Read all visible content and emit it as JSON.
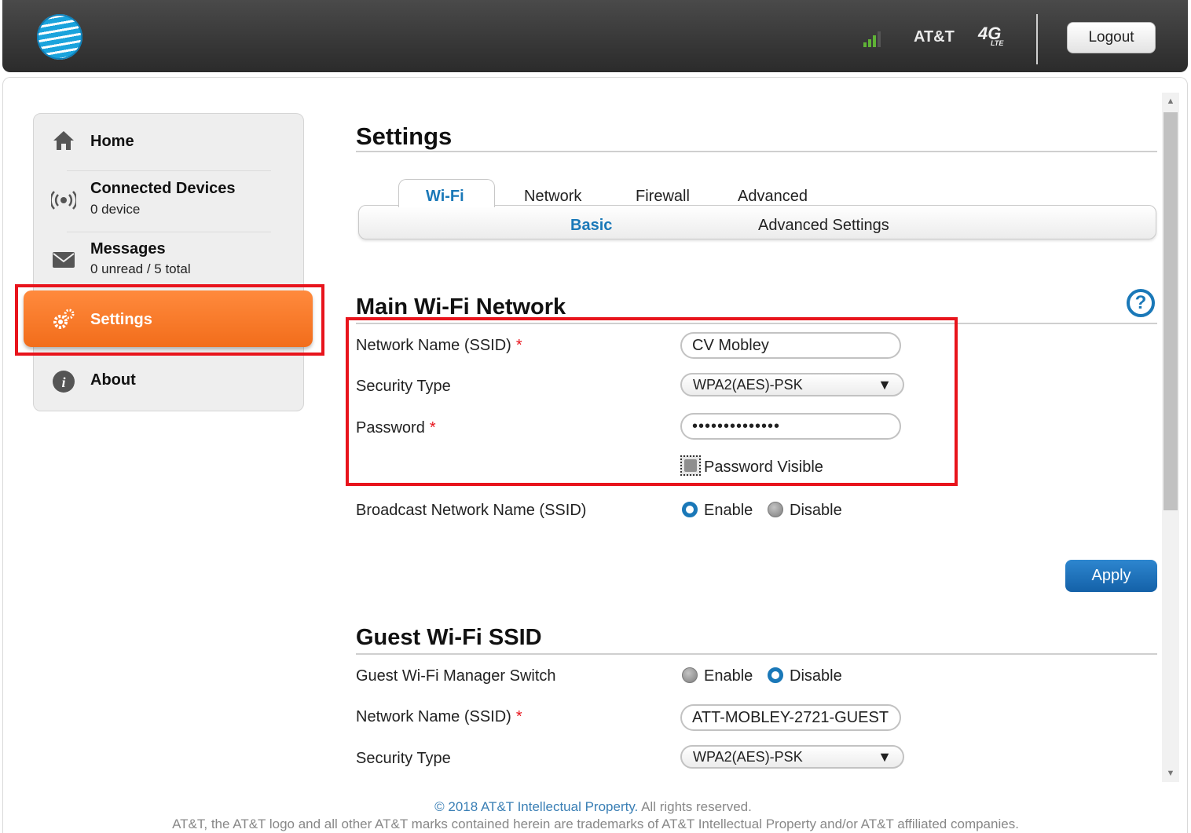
{
  "header": {
    "carrier": "AT&T",
    "network_badge": "4G",
    "network_badge_sub": "LTE",
    "logout_label": "Logout",
    "signal_bars": 3
  },
  "sidebar": {
    "home": {
      "label": "Home"
    },
    "connected_devices": {
      "label": "Connected Devices",
      "sub": "0 device"
    },
    "messages": {
      "label": "Messages",
      "sub": "0 unread / 5 total"
    },
    "settings": {
      "label": "Settings"
    },
    "about": {
      "label": "About"
    }
  },
  "page_title": "Settings",
  "tabs": [
    {
      "label": "Wi-Fi",
      "active": true
    },
    {
      "label": "Network",
      "active": false
    },
    {
      "label": "Firewall",
      "active": false
    },
    {
      "label": "Advanced",
      "active": false
    }
  ],
  "subtabs": [
    {
      "label": "Basic",
      "active": true
    },
    {
      "label": "Advanced Settings",
      "active": false
    }
  ],
  "main_wifi": {
    "title": "Main Wi-Fi Network",
    "ssid_label": "Network Name (SSID)",
    "ssid_value": "CV Mobley",
    "security_label": "Security Type",
    "security_value": "WPA2(AES)-PSK",
    "password_label": "Password",
    "password_value": "••••••••••••••",
    "password_visible_label": "Password Visible",
    "broadcast_label": "Broadcast Network Name (SSID)",
    "enable_label": "Enable",
    "disable_label": "Disable",
    "apply_label": "Apply"
  },
  "guest_wifi": {
    "title": "Guest Wi-Fi SSID",
    "switch_label": "Guest Wi-Fi Manager Switch",
    "enable_label": "Enable",
    "disable_label": "Disable",
    "ssid_label": "Network Name (SSID)",
    "ssid_value": "ATT-MOBLEY-2721-GUEST",
    "security_label": "Security Type",
    "security_value": "WPA2(AES)-PSK"
  },
  "required_marker": "*",
  "footer": {
    "copyright_link": "© 2018 AT&T Intellectual Property.",
    "copyright_rest": " All rights reserved.",
    "trademark": "AT&T, the AT&T logo and all other AT&T marks contained herein are trademarks of AT&T Intellectual Property and/or AT&T affiliated companies."
  },
  "colors": {
    "accent_blue": "#1a78b8",
    "settings_orange": "#f26d1b",
    "highlight_red": "#e8141c"
  }
}
